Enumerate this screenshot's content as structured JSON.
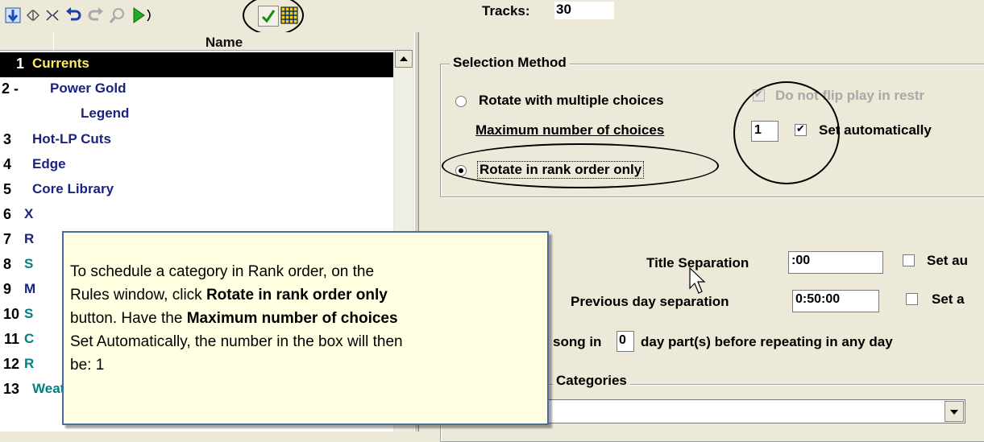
{
  "toolbar": {
    "icons": [
      "arrow-down-icon",
      "split-arrows-icon",
      "merge-arrows-icon",
      "undo-icon",
      "redo-icon",
      "find-icon",
      "play-icon",
      "checkmark-icon",
      "grid-icon"
    ]
  },
  "list": {
    "header": "Name",
    "rows": [
      {
        "num": "1",
        "label": "Currents",
        "selected": true
      },
      {
        "num": "2 -",
        "label": "Power Gold"
      },
      {
        "num": "",
        "label": "Legend"
      },
      {
        "num": "3",
        "label": "Hot-LP Cuts"
      },
      {
        "num": "4",
        "label": "Edge"
      },
      {
        "num": "5",
        "label": "Core Library"
      },
      {
        "num": "6",
        "label": "X"
      },
      {
        "num": "7",
        "label": "R"
      },
      {
        "num": "8",
        "label": "S"
      },
      {
        "num": "9",
        "label": "M"
      },
      {
        "num": "10",
        "label": "S"
      },
      {
        "num": "11",
        "label": "C"
      },
      {
        "num": "12",
        "label": "R"
      },
      {
        "num": "13",
        "label": "Weather"
      }
    ]
  },
  "right": {
    "tracks_label": "Tracks:",
    "tracks_value": "30",
    "selection_method": {
      "title": "Selection Method",
      "rotate_multiple": "Rotate with multiple choices",
      "no_flip": "Do not flip play in restr",
      "max_choices_label": "Maximum number of choices",
      "max_choices_value": "1",
      "set_auto": "Set automatically",
      "rank_order": "Rotate in rank order only"
    },
    "title_sep_label": "Title Separation",
    "title_sep_value": ":00",
    "title_sep_set": "Set au",
    "prev_day_label": "Previous day separation",
    "prev_day_value": "0:50:00",
    "prev_day_set": "Set a",
    "song_in_prefix": "song in",
    "song_in_value": "0",
    "song_in_suffix": "day part(s) before repeating in any day",
    "categories_title": "Categories"
  },
  "tooltip": {
    "t1": "To schedule a category in Rank order, on the",
    "t2a": "Rules window, click ",
    "t2b": "Rotate in rank order only",
    "t3a": "button.  Have the ",
    "t3b": "Maximum number of choices",
    "t4": "Set Automatically, the number in the box will then",
    "t5": "be: 1"
  }
}
